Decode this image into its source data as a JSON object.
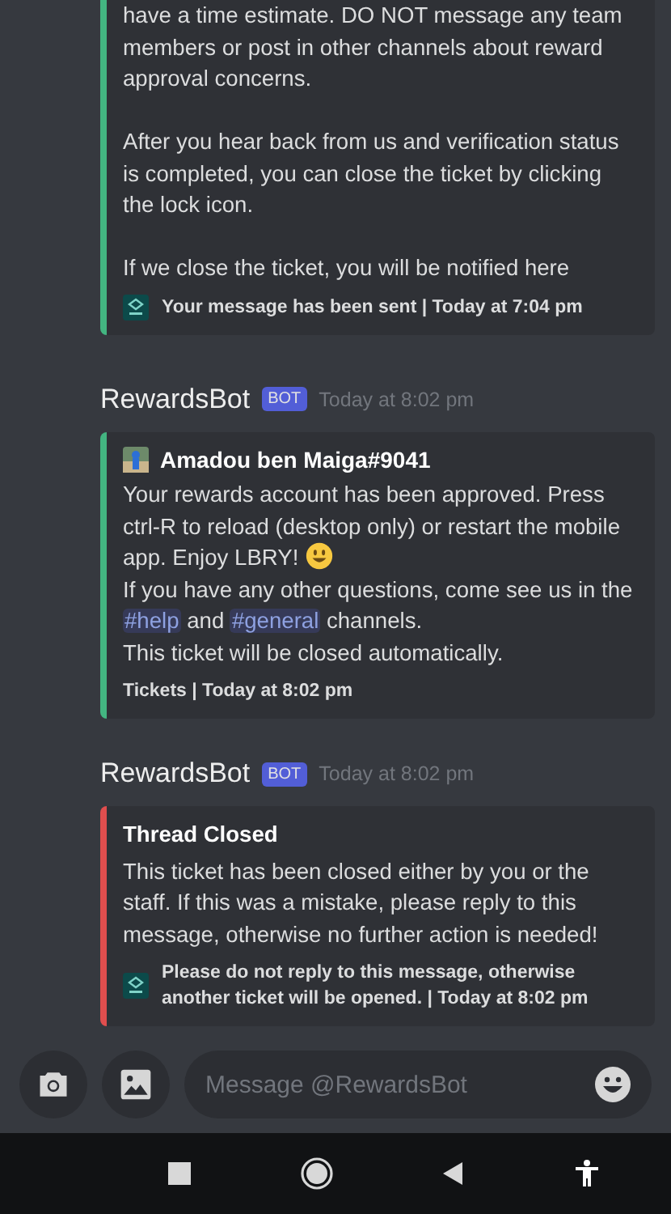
{
  "messages": [
    {
      "embed": {
        "color": "#43b581",
        "paragraphs": [
          [
            [
              {
                "kind": "text",
                "text": "have a time estimate. DO NOT message any team members or post in other channels about reward approval concerns."
              }
            ]
          ],
          [
            [
              {
                "kind": "text",
                "text": "After you hear back from us and verification status is completed, you can close the ticket by clicking the lock icon."
              }
            ]
          ],
          [
            [
              {
                "kind": "text",
                "text": "If we close the ticket, you will be notified here"
              }
            ]
          ]
        ],
        "footer": {
          "icon": true,
          "text": "Your message has been sent | Today at 7:04 pm"
        }
      }
    },
    {
      "header": {
        "name": "RewardsBot",
        "badge": "BOT",
        "time": "Today at 8:02 pm"
      },
      "embed": {
        "color": "#43b581",
        "author": "Amadou ben Maiga#9041",
        "paragraphs": [
          [
            [
              {
                "kind": "text",
                "text": "Your rewards account has been approved. Press ctrl-R to reload (desktop only) or restart the mobile app. Enjoy LBRY! "
              },
              {
                "kind": "emoji"
              }
            ],
            [
              {
                "kind": "text",
                "text": "If you have any other questions, come see us in the "
              },
              {
                "kind": "mention",
                "text": "#help"
              },
              {
                "kind": "text",
                "text": " and "
              },
              {
                "kind": "mention",
                "text": "#general"
              },
              {
                "kind": "text",
                "text": " channels."
              }
            ],
            [
              {
                "kind": "text",
                "text": "This ticket will be closed automatically."
              }
            ]
          ]
        ],
        "footer": {
          "icon": false,
          "text": "Tickets | Today at 8:02 pm"
        }
      }
    },
    {
      "header": {
        "name": "RewardsBot",
        "badge": "BOT",
        "time": "Today at 8:02 pm"
      },
      "embed": {
        "color": "#e04e4e",
        "title": "Thread Closed",
        "paragraphs": [
          [
            [
              {
                "kind": "text",
                "text": "This ticket has been closed either by you or the staff. If this was a mistake, please reply to this message, otherwise no further action is needed!"
              }
            ]
          ]
        ],
        "footer": {
          "icon": true,
          "text": "Please do not reply to this message, otherwise another ticket will be opened. | Today at 8:02 pm"
        }
      }
    }
  ],
  "composer": {
    "placeholder": "Message @RewardsBot"
  }
}
